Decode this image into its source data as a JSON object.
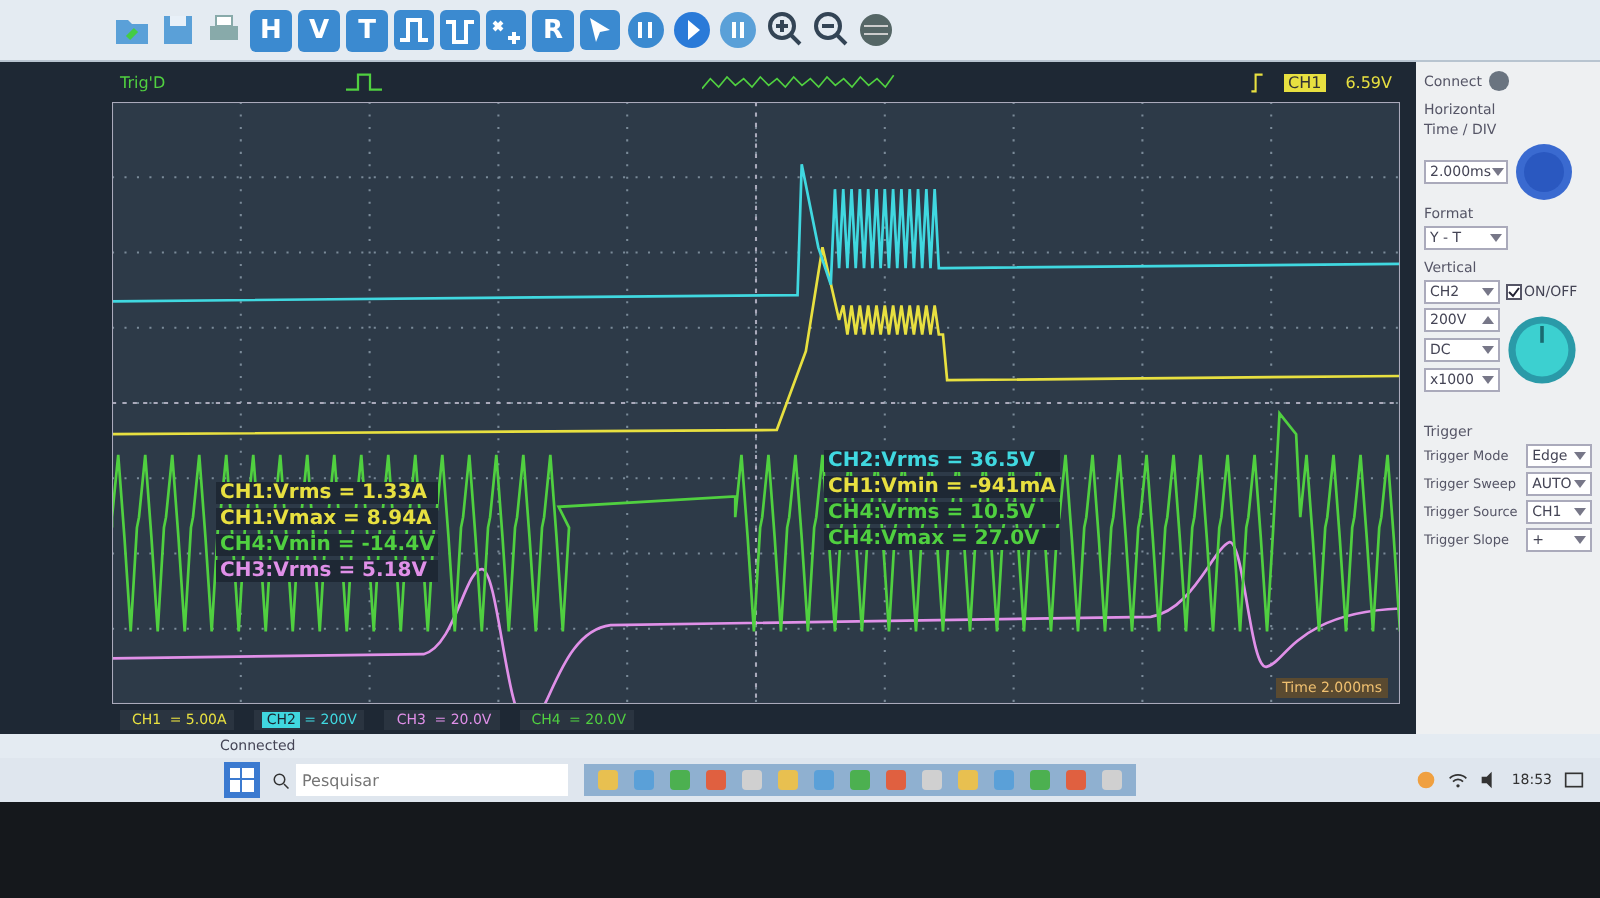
{
  "toolbar": {
    "letter_buttons": [
      "H",
      "V",
      "T",
      "R"
    ]
  },
  "trigger_bar": {
    "status": "Trig'D",
    "source": "CH1",
    "level": "6.59V"
  },
  "side_panel": {
    "connect_label": "Connect",
    "horizontal_title": "Horizontal",
    "time_div_label": "Time / DIV",
    "time_div": "2.000ms",
    "format_label": "Format",
    "format": "Y - T",
    "vertical_title": "Vertical",
    "vertical_channel": "CH2",
    "onoff_label": "ON/OFF",
    "onoff_checked": true,
    "volts_div": "200V",
    "coupling": "DC",
    "probe": "x1000",
    "trigger_title": "Trigger",
    "trigger_rows": [
      {
        "label": "Trigger Mode",
        "value": "Edge"
      },
      {
        "label": "Trigger Sweep",
        "value": "AUTO"
      },
      {
        "label": "Trigger Source",
        "value": "CH1"
      },
      {
        "label": "Trigger Slope",
        "value": "+"
      }
    ]
  },
  "measurements_left": [
    {
      "text": "CH1:Vrms = 1.33A",
      "color": "#e8e040"
    },
    {
      "text": "CH1:Vmax = 8.94A",
      "color": "#e8e040"
    },
    {
      "text": "CH4:Vmin = -14.4V",
      "color": "#50d040"
    },
    {
      "text": "CH3:Vrms = 5.18V",
      "color": "#e090e8"
    }
  ],
  "measurements_right": [
    {
      "text": "CH2:Vrms = 36.5V",
      "color": "#40d8e0"
    },
    {
      "text": "CH1:Vmin = -941mA",
      "color": "#e8e040"
    },
    {
      "text": "CH4:Vrms = 10.5V",
      "color": "#50d040"
    },
    {
      "text": "CH4:Vmax = 27.0V",
      "color": "#50d040"
    }
  ],
  "time_label": "Time 2.000ms",
  "channels": [
    {
      "label": "CH1",
      "value": "= 5.00A",
      "color": "#e8e040",
      "selected": false
    },
    {
      "label": "CH2",
      "value": "= 200V",
      "color": "#40d8e0",
      "selected": true
    },
    {
      "label": "CH3",
      "value": "= 20.0V",
      "color": "#e090e8",
      "selected": false
    },
    {
      "label": "CH4",
      "value": "= 20.0V",
      "color": "#50d040",
      "selected": false
    }
  ],
  "status": "Connected",
  "taskbar": {
    "search_placeholder": "Pesquisar",
    "clock": "18:53"
  }
}
